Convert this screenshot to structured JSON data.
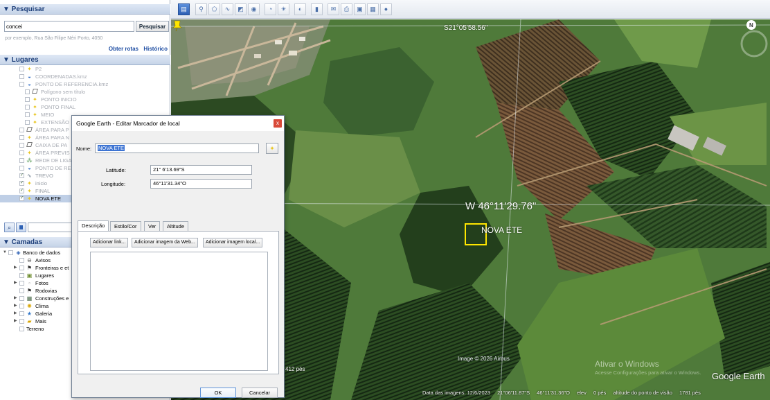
{
  "search": {
    "header": "▼ Pesquisar",
    "query": "concei",
    "button": "Pesquisar",
    "example": "por exemplo, Rua São Filipe Néri Porto, 4050",
    "routes_link": "Obter rotas",
    "history_link": "Histórico"
  },
  "places": {
    "header": "▼ Lugares",
    "items": [
      {
        "label": "P2"
      },
      {
        "label": "COORDENADAS.kmz"
      },
      {
        "label": "PONTO DE REFERENCIA.kmz"
      },
      {
        "label": "Polígono sem título"
      },
      {
        "label": "PONTO INICIO"
      },
      {
        "label": "PONTO FINAL"
      },
      {
        "label": "MEIO"
      },
      {
        "label": "EXTENSÃO"
      },
      {
        "label": "ÁREA PARA P"
      },
      {
        "label": "ÁREA PARA N"
      },
      {
        "label": "CAIXA DE PA"
      },
      {
        "label": "ÁREA PREVIS"
      },
      {
        "label": "REDE DE LIGA"
      },
      {
        "label": "PONTO DE RE"
      },
      {
        "label": "TREVO"
      },
      {
        "label": "inicio"
      },
      {
        "label": "FINAL"
      },
      {
        "label": "NOVA ETE"
      }
    ]
  },
  "layers": {
    "header": "▼ Camadas",
    "items": [
      {
        "label": "Banco de dados"
      },
      {
        "label": "Avisos"
      },
      {
        "label": "Fronteiras e et"
      },
      {
        "label": "Lugares"
      },
      {
        "label": "Fotos"
      },
      {
        "label": "Rodovias"
      },
      {
        "label": "Construções e"
      },
      {
        "label": "Clima"
      },
      {
        "label": "Galeria"
      },
      {
        "label": "Mais"
      },
      {
        "label": "Terreno"
      }
    ]
  },
  "dialog": {
    "title": "Google Earth - Editar Marcador de local",
    "close": "x",
    "name_label": "Nome:",
    "name_value": "NOVA ETE",
    "latitude_label": "Latitude:",
    "latitude_value": "21° 6'13.69\"S",
    "longitude_label": "Longitude:",
    "longitude_value": "46°11'31.34\"O",
    "tabs": [
      "Descrição",
      "Estilo/Cor",
      "Ver",
      "Altitude"
    ],
    "buttons": [
      "Adicionar link...",
      "Adicionar imagem da Web...",
      "Adicionar imagem local..."
    ],
    "ok": "OK",
    "cancel": "Cancelar"
  },
  "map": {
    "coord_top": "S21°05'58.56\"",
    "coord_mid": "W 46°11'29.76\"",
    "placemark_label": "NOVA ETE",
    "copyright": "Image © 2026 Airbus",
    "scale": "412 pés",
    "watermark_title": "Ativar o Windows",
    "watermark_sub": "Acesse Configurações para ativar o Windows.",
    "logo": "Google Earth",
    "status": {
      "date": "Data das imagens: 12/6/2023",
      "lat": "21°06'11.87\"S",
      "lon": "46°11'31.36\"O",
      "elev_label": "elev",
      "elev_value": "0 pés",
      "eye_alt_label": "altitude do ponto de visão",
      "eye_alt_value": "1781 pés"
    }
  },
  "colors": {
    "panel_header": "#1d3f7a",
    "link": "#1f4ea3",
    "placemark": "#ffe600",
    "selection": "#3d74d3"
  }
}
